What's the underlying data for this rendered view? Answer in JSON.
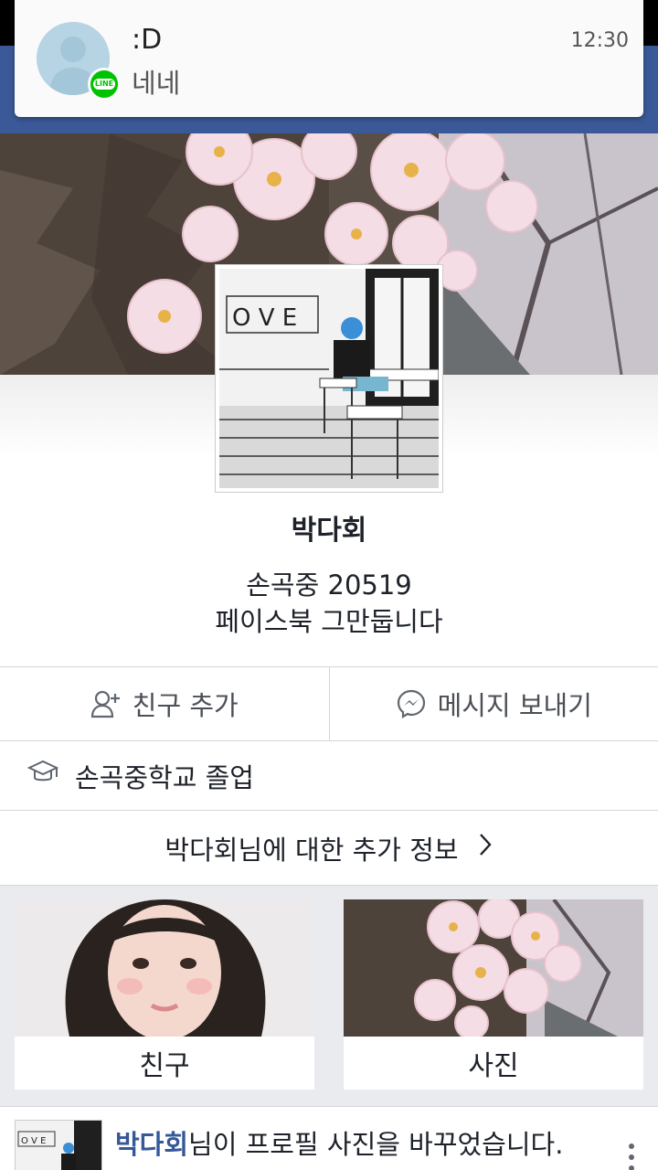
{
  "notification": {
    "app_icon": "line-icon",
    "app_badge_text": "LINE",
    "title": ":D",
    "message": "네네",
    "time": "12:30"
  },
  "profile": {
    "name": "박다회",
    "bio_line1": "손곡중 20519",
    "bio_line2": "페이스북 그만둡니다"
  },
  "actions": {
    "add_friend_label": "친구 추가",
    "add_friend_icon": "add-friend-icon",
    "message_label": "메시지 보내기",
    "message_icon": "messenger-icon"
  },
  "education": {
    "icon": "graduation-cap-icon",
    "text": "손곡중학교 졸업"
  },
  "more_info": {
    "label": "박다회님에 대한 추가 정보",
    "icon": "chevron-right-icon"
  },
  "tiles": [
    {
      "label": "친구"
    },
    {
      "label": "사진"
    }
  ],
  "post": {
    "author": "박다회",
    "text": "님이 프로필 사진을 바꾸었습니다."
  },
  "colors": {
    "facebook_blue": "#3b5998",
    "line_green": "#00c300",
    "link_blue": "#365899"
  }
}
